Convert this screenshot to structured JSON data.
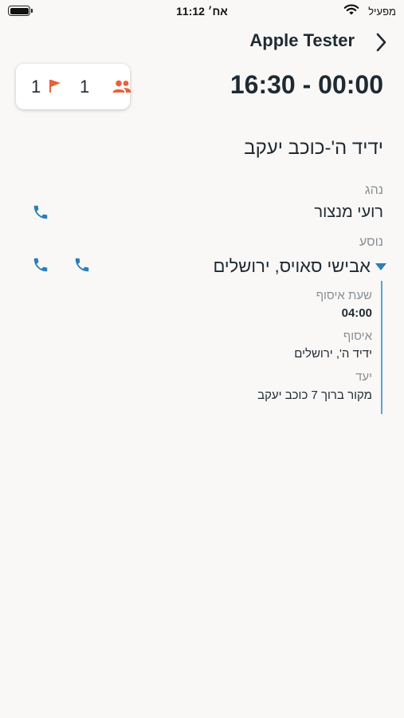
{
  "status_bar": {
    "time": "11:12 אח׳",
    "carrier": "מפעיל",
    "wifi_icon": "wifi-icon",
    "battery_icon": "battery-icon"
  },
  "header": {
    "title": "Apple Tester",
    "chevron_icon": "chevron-right-icon"
  },
  "counters": {
    "flag_count": "1",
    "people_count": "1",
    "accent_color": "#e8613c"
  },
  "ride": {
    "time_range": "16:30 - 00:00",
    "title": "ידיד ה'-כוכב יעקב"
  },
  "driver": {
    "label": "נהג",
    "name": "רועי מנצור"
  },
  "passenger": {
    "label": "נוסע",
    "name": "אבישי סאויס, ירושלים",
    "pickup_time_label": "שעת איסוף",
    "pickup_time": "04:00",
    "pickup_label": "איסוף",
    "pickup": "ידיד ה', ירושלים",
    "destination_label": "יעד",
    "destination": "מקור ברוך 7 כוכב יעקב"
  },
  "colors": {
    "phone_icon": "#2a7fb8",
    "text": "#1f2a33",
    "muted": "#8a8f94"
  }
}
